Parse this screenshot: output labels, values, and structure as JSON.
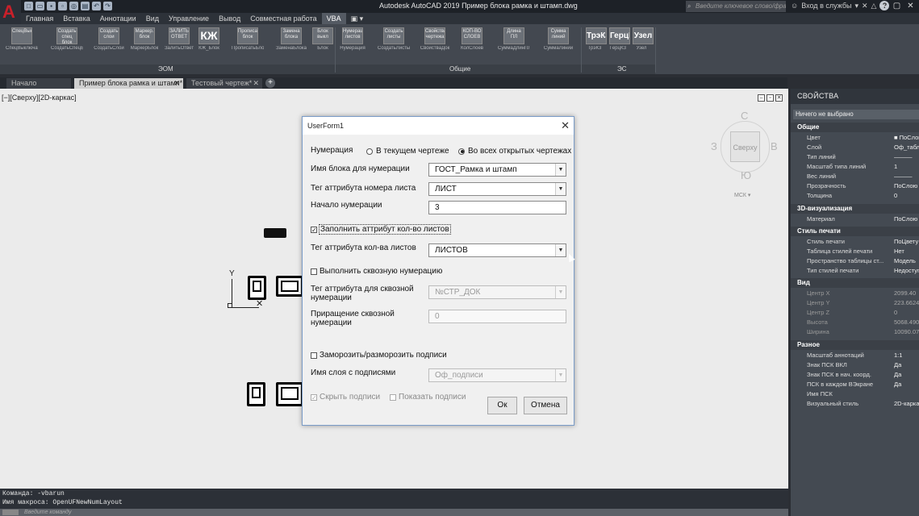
{
  "window": {
    "title": "Autodesk AutoCAD 2019    Пример блока рамка и штамп.dwg",
    "search_placeholder": "Введите ключевое слово/фразу",
    "signin": "Вход в службы",
    "help": "?"
  },
  "ribbon": {
    "tabs": [
      "Главная",
      "Вставка",
      "Аннотации",
      "Вид",
      "Управление",
      "Вывод",
      "Совместная работа",
      "VBA"
    ],
    "active_tab": 7,
    "buttons": [
      {
        "icon": "СпецВыкл",
        "label": "СпецВыключатели"
      },
      {
        "icon": "Создать спец блок",
        "label": "СоздатьСпецБлок"
      },
      {
        "icon": "Создать слои",
        "label": "СоздатьСлои"
      },
      {
        "icon": "Маркер. блок",
        "label": "МаркерБлок"
      },
      {
        "icon": "ЗАЛИТЬ ОТВЕТ",
        "label": "ЗалитьОтвет"
      },
      {
        "icon": "КЖ",
        "label": "КЖ_Блок"
      },
      {
        "icon": "Прописать блок",
        "label": "ПрописатьБлок"
      },
      {
        "icon": "Замена блока",
        "label": "ЗаменаБлока"
      },
      {
        "icon": "Блок выкл",
        "label": "Блок"
      },
      {
        "icon": "Нумерация листов",
        "label": "Нумерация"
      },
      {
        "icon": "Создать листы",
        "label": "СоздатьЛисты"
      },
      {
        "icon": "Свойства чертежа",
        "label": "СвойстваДок"
      },
      {
        "icon": "КОП-ВО СЛОЕВ",
        "label": "КолСлоев"
      },
      {
        "icon": "Длина ПЛ",
        "label": "СуммаДлинПЛ"
      },
      {
        "icon": "Сумма линий",
        "label": "СуммаЛиний"
      },
      {
        "icon": "ТрэК3",
        "label": "ТрэК3"
      },
      {
        "icon": "ГерцКЗ",
        "label": "ГерцКЗ"
      },
      {
        "icon": "Узел",
        "label": "Узел"
      }
    ],
    "panels": [
      "ЭОМ",
      "Общие",
      "ЭС"
    ]
  },
  "file_tabs": [
    {
      "label": "Начало"
    },
    {
      "label": "Пример блока рамка и штамп*"
    },
    {
      "label": "Тестовый чертеж*"
    }
  ],
  "viewport": {
    "label": "[−][Сверху][2D-каркас]",
    "viewcube": {
      "n": "С",
      "s": "Ю",
      "w": "З",
      "e": "В",
      "face": "Сверху",
      "ucs": "МСК"
    }
  },
  "command_line": {
    "lines": [
      "Команда: -vbarun",
      "Имя макроса: OpenUFNewNumLayout"
    ],
    "placeholder": "Введите команду"
  },
  "properties": {
    "title": "СВОЙСТВА",
    "selection": "Ничего не выбрано",
    "sections": [
      {
        "name": "Общие",
        "rows": [
          [
            "Цвет",
            "ПоСлою"
          ],
          [
            "Слой",
            "Оф_табли"
          ],
          [
            "Тип линий",
            "———"
          ],
          [
            "Масштаб типа линий",
            "1"
          ],
          [
            "Вес линий",
            "———"
          ],
          [
            "Прозрачность",
            "ПоСлою"
          ],
          [
            "Толщина",
            "0"
          ]
        ]
      },
      {
        "name": "3D-визуализация",
        "rows": [
          [
            "Материал",
            "ПоСлою"
          ]
        ]
      },
      {
        "name": "Стиль печати",
        "rows": [
          [
            "Стиль печати",
            "ПоЦвету"
          ],
          [
            "Таблица стилей печати",
            "Нет"
          ],
          [
            "Пространство таблицы ст...",
            "Модель"
          ],
          [
            "Тип стилей печати",
            "Недоступ"
          ]
        ]
      },
      {
        "name": "Вид",
        "rows": [
          [
            "Центр X",
            "2099.40"
          ],
          [
            "Центр Y",
            "223.6624"
          ],
          [
            "Центр Z",
            "0"
          ],
          [
            "Высота",
            "5068.490"
          ],
          [
            "Ширина",
            "10090.07"
          ]
        ]
      },
      {
        "name": "Разное",
        "rows": [
          [
            "Масштаб аннотаций",
            "1:1"
          ],
          [
            "Знак ПСК ВКЛ",
            "Да"
          ],
          [
            "Знак ПСК в нач. коорд.",
            "Да"
          ],
          [
            "ПСК в каждом ВЭкране",
            "Да"
          ],
          [
            "Имя ПСК",
            ""
          ],
          [
            "Визуальный стиль",
            "2D-карка"
          ]
        ]
      }
    ]
  },
  "dialog": {
    "title": "UserForm1",
    "numbering_label": "Нумерация",
    "radio_current": "В текущем чертеже",
    "radio_all": "Во всех открытых чертежах",
    "block_name_label": "Имя блока для нумерации",
    "block_name_value": "ГОСТ_Рамка и штамп",
    "sheet_tag_label": "Тег аттрибута номера листа",
    "sheet_tag_value": "ЛИСТ",
    "start_label": "Начало нумерации",
    "start_value": "3",
    "fill_count_label": "Заполнить аттрибут кол-во листов",
    "count_tag_label": "Тег аттрибута кол-ва листов",
    "count_tag_value": "ЛИСТОВ",
    "through_label": "Выполнить сквозную нумерацию",
    "through_tag_label": "Тег аттрибута для сквозной нумерации",
    "through_tag_value": "№СТР_ДОК",
    "increment_label": "Приращение сквозной нумерации",
    "increment_value": "0",
    "freeze_label": "Заморозить/разморозить подписи",
    "layer_label": "Имя слоя с подписями",
    "layer_value": "Оф_подписи",
    "hide_label": "Скрыть подписи",
    "show_label": "Показать подписи",
    "ok": "Ок",
    "cancel": "Отмена"
  }
}
